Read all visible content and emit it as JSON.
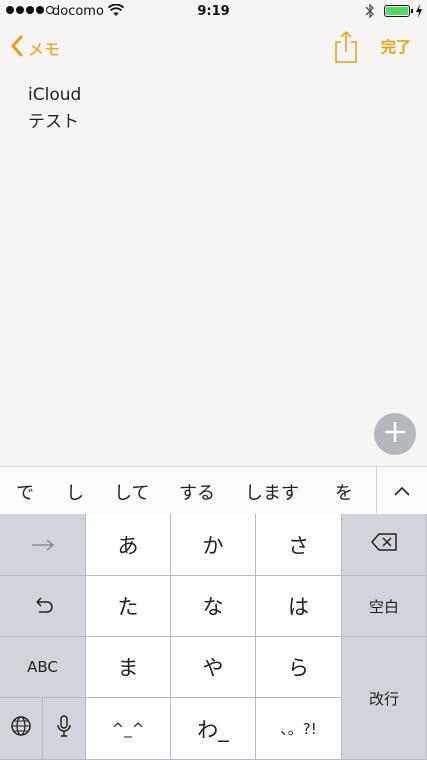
{
  "status_bar": {
    "carrier": "docomo",
    "time": "9:19",
    "signal_bars": 4,
    "signal_total": 5,
    "battery_level": 1.0
  },
  "nav": {
    "back_label": "メモ",
    "done_label": "完了",
    "accent_color": "#e5a214"
  },
  "note": {
    "lines": [
      "iCloud",
      "テスト"
    ]
  },
  "suggestions": {
    "items": [
      "で",
      "し",
      "して",
      "する",
      "します",
      "を"
    ]
  },
  "keyboard": {
    "keys": {
      "a": "あ",
      "ka": "か",
      "sa": "さ",
      "ta": "た",
      "na": "な",
      "ha": "は",
      "ma": "ま",
      "ya": "や",
      "ra": "ら",
      "kaomoji": "^_^",
      "wa": "わ_",
      "punct": "、。?!",
      "abc": "ABC",
      "space": "空白",
      "return": "改行"
    }
  }
}
